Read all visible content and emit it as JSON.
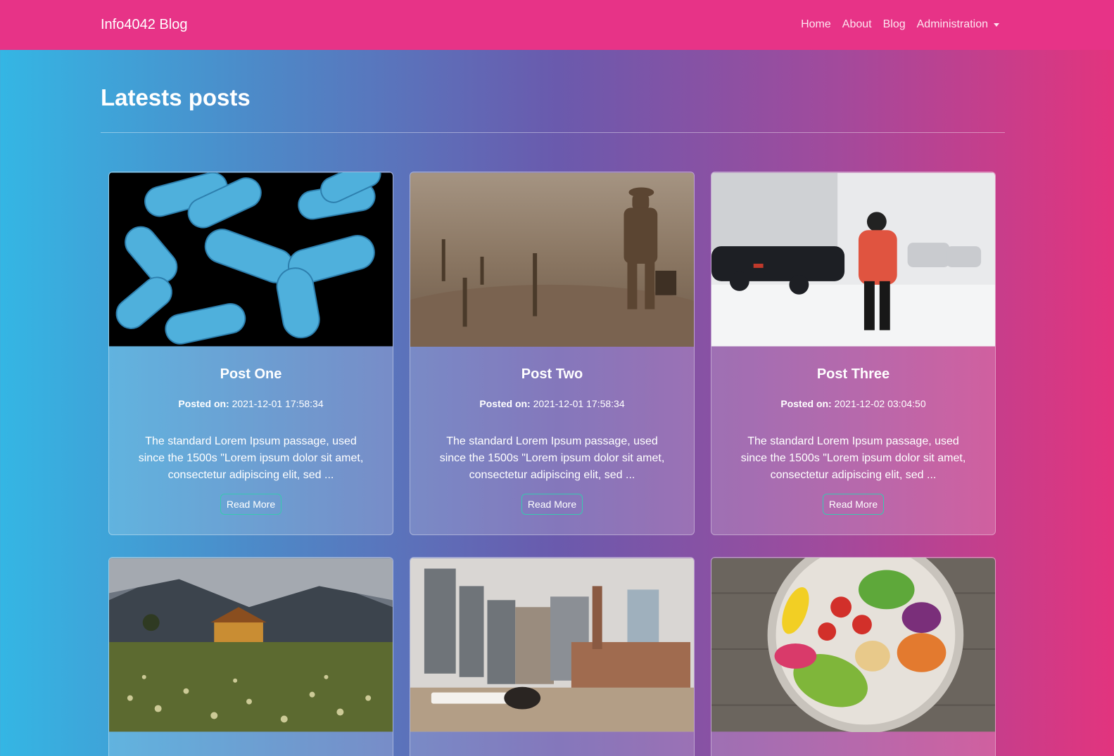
{
  "navbar": {
    "brand": "Info4042 Blog",
    "links": [
      "Home",
      "About",
      "Blog",
      "Administration"
    ]
  },
  "page": {
    "heading": "Latests posts"
  },
  "posts": [
    {
      "title": "Post One",
      "posted_label": "Posted on:",
      "posted_value": "2021-12-01 17:58:34",
      "excerpt": "The standard Lorem Ipsum passage, used since the 1500s \"Lorem ipsum dolor sit amet, consectetur adipiscing elit, sed ...",
      "button": "Read More",
      "image": "bacteria-image"
    },
    {
      "title": "Post Two",
      "posted_label": "Posted on:",
      "posted_value": "2021-12-01 17:58:34",
      "excerpt": "The standard Lorem Ipsum passage, used since the 1500s \"Lorem ipsum dolor sit amet, consectetur adipiscing elit, sed ...",
      "button": "Read More",
      "image": "toy-soldier-image"
    },
    {
      "title": "Post Three",
      "posted_label": "Posted on:",
      "posted_value": "2021-12-02 03:04:50",
      "excerpt": "The standard Lorem Ipsum passage, used since the 1500s \"Lorem ipsum dolor sit amet, consectetur adipiscing elit, sed ...",
      "button": "Read More",
      "image": "snow-walker-image"
    },
    {
      "image": "mountain-house-image"
    },
    {
      "image": "toronto-city-image"
    },
    {
      "image": "salad-bowl-image"
    }
  ]
}
